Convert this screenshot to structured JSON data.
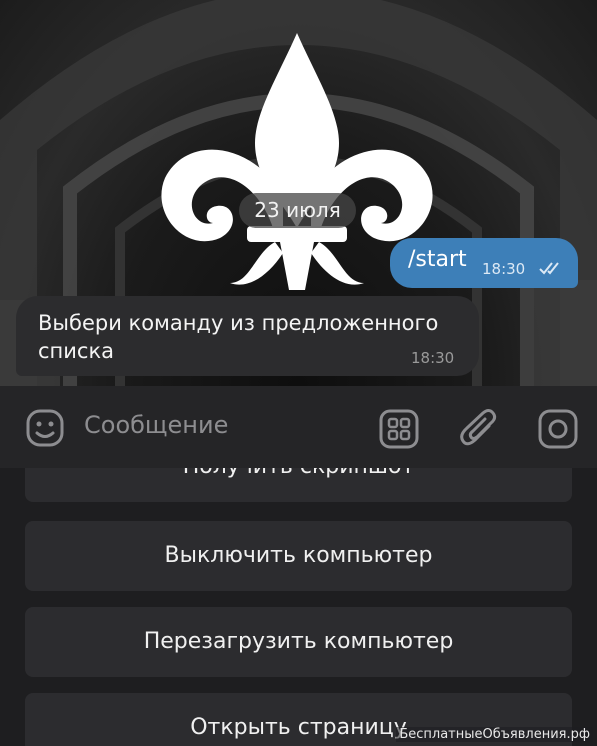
{
  "chat": {
    "date_separator": "23 июля",
    "messages": [
      {
        "direction": "outgoing",
        "text": "/start",
        "time": "18:30",
        "status": "read"
      },
      {
        "direction": "incoming",
        "text": "Выбери команду из предложенного списка",
        "time": "18:30"
      }
    ]
  },
  "composer": {
    "placeholder": "Сообщение",
    "icons": [
      "emoji-icon",
      "bot-keyboard-icon",
      "attach-icon",
      "camera-icon"
    ]
  },
  "keyboard": {
    "buttons": [
      "Получить скриншот",
      "Выключить компьютер",
      "Перезагрузить компьютер",
      "Открыть страницу"
    ]
  },
  "watermark": "БесплатныеОбъявления.рф",
  "colors": {
    "outgoing_bubble": "#3d7fb8",
    "incoming_bubble": "#2c2c2e",
    "keyboard_button": "#2c2c2f",
    "composer": "#252527"
  }
}
